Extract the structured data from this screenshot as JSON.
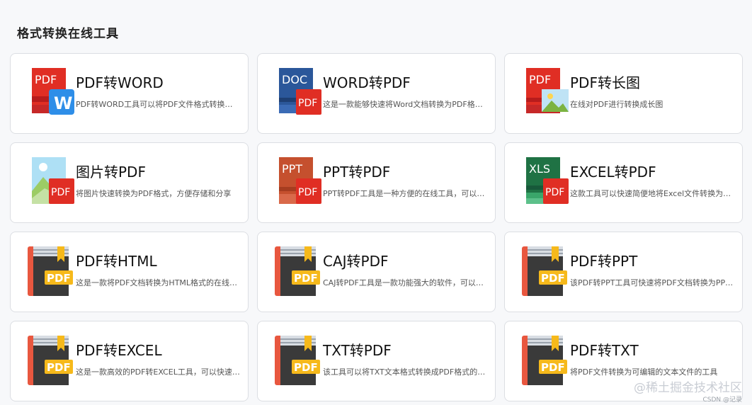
{
  "heading": "格式转换在线工具",
  "tools": [
    {
      "title": "PDF转WORD",
      "desc": "PDF转WORD工具可以将PDF文件格式转换为WORD文档",
      "icon": "pdf-to-word-icon"
    },
    {
      "title": "WORD转PDF",
      "desc": "这是一款能够快速将Word文档转换为PDF格式的工具",
      "icon": "word-to-pdf-icon"
    },
    {
      "title": "PDF转长图",
      "desc": "在线对PDF进行转换成长图",
      "icon": "pdf-to-image-icon"
    },
    {
      "title": "图片转PDF",
      "desc": "将图片快速转换为PDF格式，方便存储和分享",
      "icon": "image-to-pdf-icon"
    },
    {
      "title": "PPT转PDF",
      "desc": "PPT转PDF工具是一种方便的在线工具，可以快速转换",
      "icon": "ppt-to-pdf-icon"
    },
    {
      "title": "EXCEL转PDF",
      "desc": "这款工具可以快速简便地将Excel文件转换为PDF格式",
      "icon": "excel-to-pdf-icon"
    },
    {
      "title": "PDF转HTML",
      "desc": "这是一款将PDF文档转换为HTML格式的在线工具",
      "icon": "pdf-book-icon"
    },
    {
      "title": "CAJ转PDF",
      "desc": "CAJ转PDF工具是一款功能强大的软件，可以快速转换",
      "icon": "pdf-book-icon"
    },
    {
      "title": "PDF转PPT",
      "desc": "该PDF转PPT工具可快速将PDF文档转换为PPT格式",
      "icon": "pdf-book-icon"
    },
    {
      "title": "PDF转EXCEL",
      "desc": "这是一款高效的PDF转EXCEL工具，可以快速转换表格",
      "icon": "pdf-book-icon"
    },
    {
      "title": "TXT转PDF",
      "desc": "该工具可以将TXT文本格式转换成PDF格式的在线工具",
      "icon": "pdf-book-icon"
    },
    {
      "title": "PDF转TXT",
      "desc": "将PDF文件转换为可编辑的文本文件的工具",
      "icon": "pdf-book-icon"
    }
  ],
  "icon_labels": {
    "pdf": "PDF",
    "doc": "DOC",
    "ppt": "PPT",
    "xls": "XLS",
    "w": "W"
  },
  "watermark": "@稀土掘金技术社区",
  "watermark_small": "CSDN @记录",
  "colors": {
    "pdf_red": "#e02e24",
    "word_blue": "#2b579a",
    "ppt_orange": "#c5502e",
    "excel_green": "#1f7244",
    "book_gold": "#f6b91b"
  }
}
